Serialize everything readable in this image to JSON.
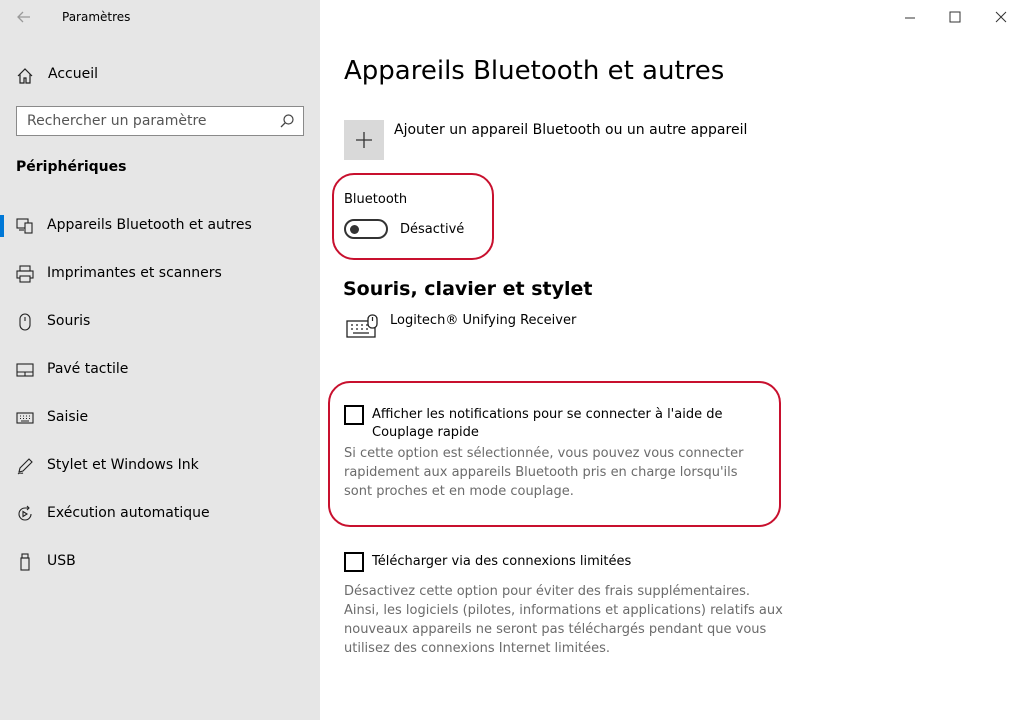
{
  "window": {
    "app_title": "Paramètres"
  },
  "sidebar": {
    "home_label": "Accueil",
    "search_placeholder": "Rechercher un paramètre",
    "section_title": "Périphériques",
    "items": [
      {
        "label": "Appareils Bluetooth et autres",
        "icon": "bluetooth-devices-icon",
        "selected": true
      },
      {
        "label": "Imprimantes et scanners",
        "icon": "printer-icon",
        "selected": false
      },
      {
        "label": "Souris",
        "icon": "mouse-icon",
        "selected": false
      },
      {
        "label": "Pavé tactile",
        "icon": "touchpad-icon",
        "selected": false
      },
      {
        "label": "Saisie",
        "icon": "keyboard-icon",
        "selected": false
      },
      {
        "label": "Stylet et Windows Ink",
        "icon": "pen-icon",
        "selected": false
      },
      {
        "label": "Exécution automatique",
        "icon": "autoplay-icon",
        "selected": false
      },
      {
        "label": "USB",
        "icon": "usb-icon",
        "selected": false
      }
    ],
    "accent_color": "#0078d7"
  },
  "main": {
    "page_title": "Appareils Bluetooth et autres",
    "add_device_label": "Ajouter un appareil Bluetooth ou un autre appareil",
    "bluetooth": {
      "label": "Bluetooth",
      "state_label": "Désactivé",
      "enabled": false
    },
    "devices_section": {
      "heading": "Souris, clavier et stylet",
      "device_name": "Logitech® Unifying Receiver",
      "device_icon": "keyboard-mouse-icon"
    },
    "swift_pair": {
      "label": "Afficher les notifications pour se connecter à l'aide de Couplage rapide",
      "checked": false,
      "description": "Si cette option est sélectionnée, vous pouvez vous connecter rapidement aux appareils Bluetooth pris en charge lorsqu'ils sont proches et en mode couplage."
    },
    "metered": {
      "label": "Télécharger via des connexions limitées",
      "checked": false,
      "description": "Désactivez cette option pour éviter des frais supplémentaires. Ainsi, les logiciels (pilotes, informations et applications) relatifs aux nouveaux appareils ne seront pas téléchargés pendant que vous utilisez des connexions Internet limitées."
    },
    "highlight_color": "#c8102e"
  }
}
